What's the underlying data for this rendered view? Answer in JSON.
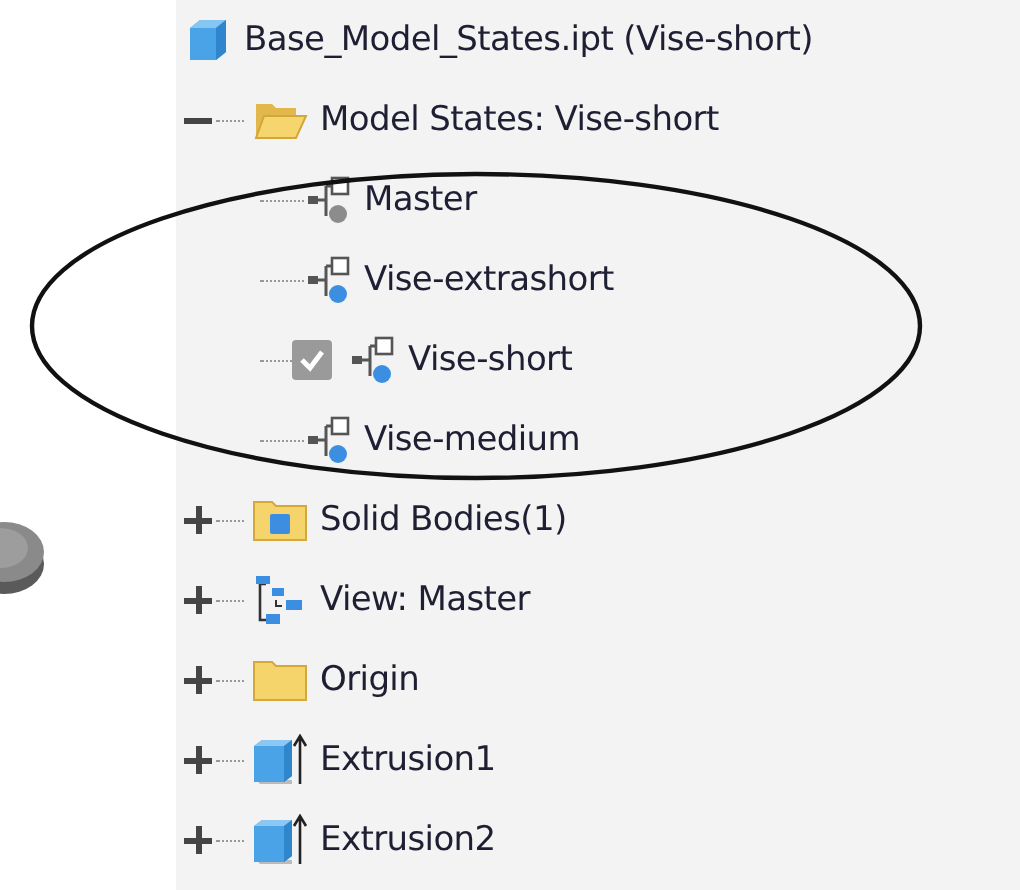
{
  "browser": {
    "root": {
      "label": "Base_Model_States.ipt (Vise-short)",
      "kind": "part"
    },
    "nodes": [
      {
        "label": "Model States: Vise-short",
        "kind": "folder-open",
        "expanded": true,
        "children": [
          {
            "label": "Master",
            "kind": "model-state",
            "checked": false,
            "color": "#8c8c8c"
          },
          {
            "label": "Vise-extrashort",
            "kind": "model-state",
            "checked": false,
            "color": "#3c8fe0"
          },
          {
            "label": "Vise-short",
            "kind": "model-state",
            "checked": true,
            "color": "#3c8fe0"
          },
          {
            "label": "Vise-medium",
            "kind": "model-state",
            "checked": false,
            "color": "#3c8fe0"
          }
        ]
      },
      {
        "label": "Solid Bodies(1)",
        "kind": "folder-body",
        "expanded": false
      },
      {
        "label": "View: Master",
        "kind": "view",
        "expanded": false
      },
      {
        "label": "Origin",
        "kind": "folder",
        "expanded": false
      },
      {
        "label": "Extrusion1",
        "kind": "extrusion",
        "expanded": false
      },
      {
        "label": "Extrusion2",
        "kind": "extrusion",
        "expanded": false
      }
    ]
  }
}
